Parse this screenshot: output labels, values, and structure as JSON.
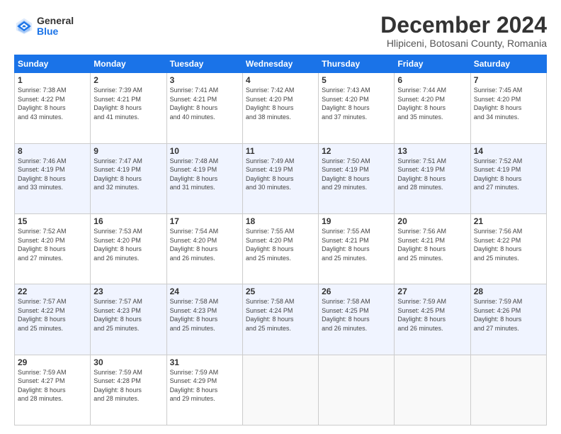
{
  "logo": {
    "general": "General",
    "blue": "Blue"
  },
  "title": "December 2024",
  "subtitle": "Hlipiceni, Botosani County, Romania",
  "days_of_week": [
    "Sunday",
    "Monday",
    "Tuesday",
    "Wednesday",
    "Thursday",
    "Friday",
    "Saturday"
  ],
  "weeks": [
    [
      {
        "day": "1",
        "info": "Sunrise: 7:38 AM\nSunset: 4:22 PM\nDaylight: 8 hours\nand 43 minutes."
      },
      {
        "day": "2",
        "info": "Sunrise: 7:39 AM\nSunset: 4:21 PM\nDaylight: 8 hours\nand 41 minutes."
      },
      {
        "day": "3",
        "info": "Sunrise: 7:41 AM\nSunset: 4:21 PM\nDaylight: 8 hours\nand 40 minutes."
      },
      {
        "day": "4",
        "info": "Sunrise: 7:42 AM\nSunset: 4:20 PM\nDaylight: 8 hours\nand 38 minutes."
      },
      {
        "day": "5",
        "info": "Sunrise: 7:43 AM\nSunset: 4:20 PM\nDaylight: 8 hours\nand 37 minutes."
      },
      {
        "day": "6",
        "info": "Sunrise: 7:44 AM\nSunset: 4:20 PM\nDaylight: 8 hours\nand 35 minutes."
      },
      {
        "day": "7",
        "info": "Sunrise: 7:45 AM\nSunset: 4:20 PM\nDaylight: 8 hours\nand 34 minutes."
      }
    ],
    [
      {
        "day": "8",
        "info": "Sunrise: 7:46 AM\nSunset: 4:19 PM\nDaylight: 8 hours\nand 33 minutes."
      },
      {
        "day": "9",
        "info": "Sunrise: 7:47 AM\nSunset: 4:19 PM\nDaylight: 8 hours\nand 32 minutes."
      },
      {
        "day": "10",
        "info": "Sunrise: 7:48 AM\nSunset: 4:19 PM\nDaylight: 8 hours\nand 31 minutes."
      },
      {
        "day": "11",
        "info": "Sunrise: 7:49 AM\nSunset: 4:19 PM\nDaylight: 8 hours\nand 30 minutes."
      },
      {
        "day": "12",
        "info": "Sunrise: 7:50 AM\nSunset: 4:19 PM\nDaylight: 8 hours\nand 29 minutes."
      },
      {
        "day": "13",
        "info": "Sunrise: 7:51 AM\nSunset: 4:19 PM\nDaylight: 8 hours\nand 28 minutes."
      },
      {
        "day": "14",
        "info": "Sunrise: 7:52 AM\nSunset: 4:19 PM\nDaylight: 8 hours\nand 27 minutes."
      }
    ],
    [
      {
        "day": "15",
        "info": "Sunrise: 7:52 AM\nSunset: 4:20 PM\nDaylight: 8 hours\nand 27 minutes."
      },
      {
        "day": "16",
        "info": "Sunrise: 7:53 AM\nSunset: 4:20 PM\nDaylight: 8 hours\nand 26 minutes."
      },
      {
        "day": "17",
        "info": "Sunrise: 7:54 AM\nSunset: 4:20 PM\nDaylight: 8 hours\nand 26 minutes."
      },
      {
        "day": "18",
        "info": "Sunrise: 7:55 AM\nSunset: 4:20 PM\nDaylight: 8 hours\nand 25 minutes."
      },
      {
        "day": "19",
        "info": "Sunrise: 7:55 AM\nSunset: 4:21 PM\nDaylight: 8 hours\nand 25 minutes."
      },
      {
        "day": "20",
        "info": "Sunrise: 7:56 AM\nSunset: 4:21 PM\nDaylight: 8 hours\nand 25 minutes."
      },
      {
        "day": "21",
        "info": "Sunrise: 7:56 AM\nSunset: 4:22 PM\nDaylight: 8 hours\nand 25 minutes."
      }
    ],
    [
      {
        "day": "22",
        "info": "Sunrise: 7:57 AM\nSunset: 4:22 PM\nDaylight: 8 hours\nand 25 minutes."
      },
      {
        "day": "23",
        "info": "Sunrise: 7:57 AM\nSunset: 4:23 PM\nDaylight: 8 hours\nand 25 minutes."
      },
      {
        "day": "24",
        "info": "Sunrise: 7:58 AM\nSunset: 4:23 PM\nDaylight: 8 hours\nand 25 minutes."
      },
      {
        "day": "25",
        "info": "Sunrise: 7:58 AM\nSunset: 4:24 PM\nDaylight: 8 hours\nand 25 minutes."
      },
      {
        "day": "26",
        "info": "Sunrise: 7:58 AM\nSunset: 4:25 PM\nDaylight: 8 hours\nand 26 minutes."
      },
      {
        "day": "27",
        "info": "Sunrise: 7:59 AM\nSunset: 4:25 PM\nDaylight: 8 hours\nand 26 minutes."
      },
      {
        "day": "28",
        "info": "Sunrise: 7:59 AM\nSunset: 4:26 PM\nDaylight: 8 hours\nand 27 minutes."
      }
    ],
    [
      {
        "day": "29",
        "info": "Sunrise: 7:59 AM\nSunset: 4:27 PM\nDaylight: 8 hours\nand 28 minutes."
      },
      {
        "day": "30",
        "info": "Sunrise: 7:59 AM\nSunset: 4:28 PM\nDaylight: 8 hours\nand 28 minutes."
      },
      {
        "day": "31",
        "info": "Sunrise: 7:59 AM\nSunset: 4:29 PM\nDaylight: 8 hours\nand 29 minutes."
      },
      {
        "day": "",
        "info": ""
      },
      {
        "day": "",
        "info": ""
      },
      {
        "day": "",
        "info": ""
      },
      {
        "day": "",
        "info": ""
      }
    ]
  ]
}
